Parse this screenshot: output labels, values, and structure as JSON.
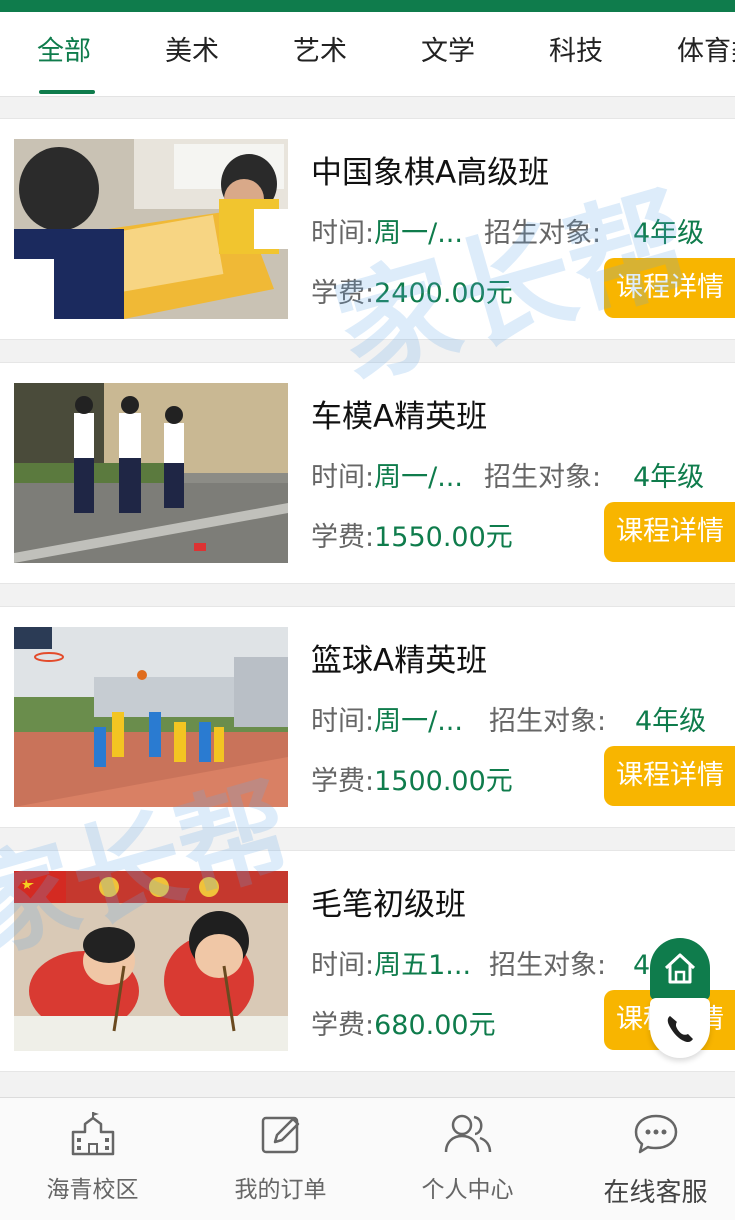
{
  "tabs": [
    "全部",
    "美术",
    "艺术",
    "文学",
    "科技",
    "体育类"
  ],
  "active_tab": 0,
  "watermark_text": "家长帮",
  "courses": [
    {
      "title": "中国象棋A高级班",
      "time_label": "时间:",
      "time_value": "周一/...",
      "target_label": "招生对象:",
      "grade": "4年级",
      "fee_label": "学费:",
      "fee_value": "2400.00元",
      "button": "课程详情",
      "image": "chess-photo"
    },
    {
      "title": "车模A精英班",
      "time_label": "时间:",
      "time_value": "周一/...",
      "target_label": "招生对象:",
      "grade": "4年级",
      "fee_label": "学费:",
      "fee_value": "1550.00元",
      "button": "课程详情",
      "image": "car-model-photo"
    },
    {
      "title": "篮球A精英班",
      "time_label": "时间:",
      "time_value": "周一/...",
      "target_label": "招生对象:",
      "grade": "4年级",
      "fee_label": "学费:",
      "fee_value": "1500.00元",
      "button": "课程详情",
      "image": "basketball-photo"
    },
    {
      "title": "毛笔初级班",
      "time_label": "时间:",
      "time_value": "周五1...",
      "target_label": "招生对象:",
      "grade": "4年级",
      "fee_label": "学费:",
      "fee_value": "680.00元",
      "button": "课程详情",
      "image": "calligraphy-photo"
    }
  ],
  "bottom_nav": [
    {
      "label": "海青校区",
      "icon": "school-icon"
    },
    {
      "label": "我的订单",
      "icon": "edit-icon"
    },
    {
      "label": "个人中心",
      "icon": "users-icon"
    },
    {
      "label": "在线客服",
      "icon": "chat-icon"
    }
  ],
  "colors": {
    "primary": "#0f7c4c",
    "button": "#f8b500"
  }
}
